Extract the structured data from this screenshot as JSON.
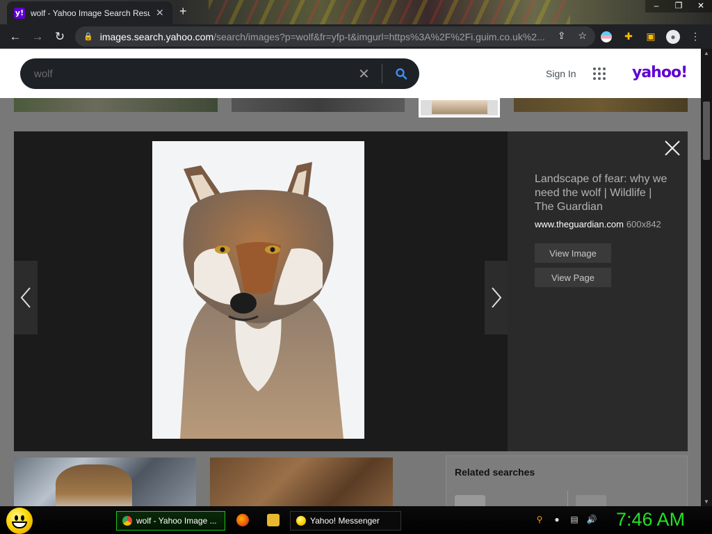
{
  "browser": {
    "tab_title": "wolf - Yahoo Image Search Results",
    "tab_favicon": "y!",
    "url_host": "images.search.yahoo.com",
    "url_path": "/search/images?p=wolf&fr=yfp-t&imgurl=https%3A%2F%2Fi.guim.co.uk%2..."
  },
  "yahoo": {
    "search_query": "wolf",
    "signin_label": "Sign In",
    "logo_text": "yahoo!",
    "brand_color": "#6001d2"
  },
  "viewer": {
    "title": "Landscape of fear: why we need the wolf | Wildlife | The Guardian",
    "source_domain": "www.theguardian.com",
    "dimensions": "600x842",
    "view_image_label": "View Image",
    "view_page_label": "View Page"
  },
  "related": {
    "heading": "Related searches"
  },
  "taskbar": {
    "task_browser": "wolf - Yahoo Image ...",
    "task_messenger": "Yahoo! Messenger",
    "clock": "7:46 AM"
  }
}
